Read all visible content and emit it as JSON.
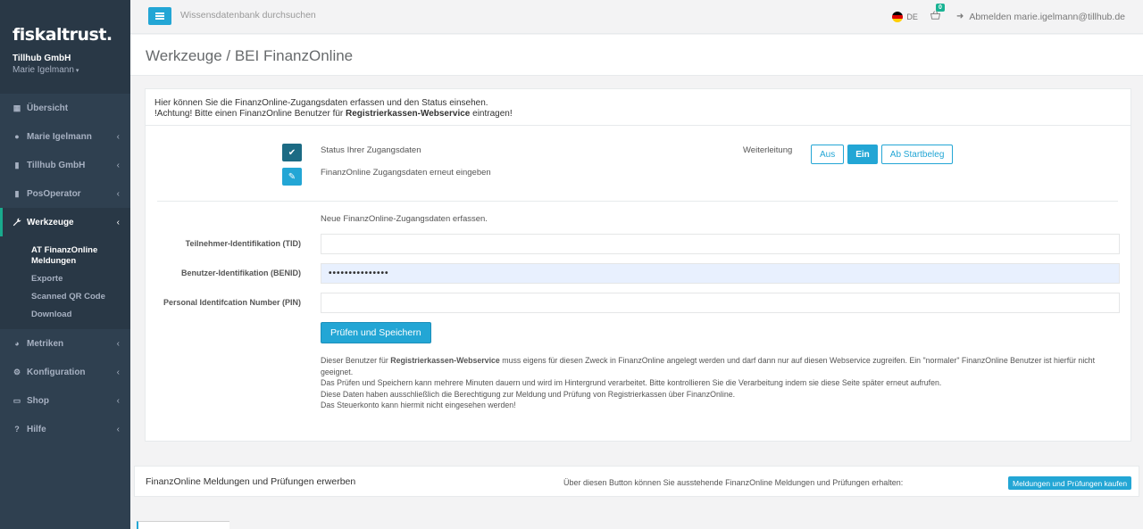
{
  "brand": {
    "logo": "fiskaltrust.",
    "company": "Tillhub GmbH",
    "user": "Marie Igelmann",
    "user_caret": "▾"
  },
  "sidebar": {
    "items": [
      {
        "label": "Übersicht",
        "icon": "th-large-icon",
        "glyph": "▦",
        "chevron": ""
      },
      {
        "label": "Marie Igelmann",
        "icon": "user-icon",
        "glyph": "●",
        "chevron": "‹"
      },
      {
        "label": "Tillhub GmbH",
        "icon": "building-icon",
        "glyph": "▮",
        "chevron": "‹"
      },
      {
        "label": "PosOperator",
        "icon": "building-icon",
        "glyph": "▮",
        "chevron": "‹"
      },
      {
        "label": "Werkzeuge",
        "icon": "wrench-icon",
        "glyph": "🔧",
        "chevron": "‹"
      },
      {
        "label": "Metriken",
        "icon": "pie-chart-icon",
        "glyph": "◕",
        "chevron": "‹"
      },
      {
        "label": "Konfiguration",
        "icon": "cogs-icon",
        "glyph": "⚙",
        "chevron": "‹"
      },
      {
        "label": "Shop",
        "icon": "cart-icon",
        "glyph": "▭",
        "chevron": "‹"
      },
      {
        "label": "Hilfe",
        "icon": "question-icon",
        "glyph": "?",
        "chevron": "‹"
      }
    ],
    "submenu": [
      {
        "label": "AT FinanzOnline Meldungen"
      },
      {
        "label": "Exporte"
      },
      {
        "label": "Scanned QR Code"
      },
      {
        "label": "Download"
      }
    ]
  },
  "topbar": {
    "search_placeholder": "Wissensdatenbank durchsuchen",
    "lang": "DE",
    "cart_count": "0",
    "logout_label": "Abmelden marie.igelmann@tillhub.de"
  },
  "page": {
    "title": "Werkzeuge / BEI FinanzOnline"
  },
  "intro": {
    "line1": "Hier können Sie die FinanzOnline-Zugangsdaten erfassen und den Status einsehen.",
    "line2_pre": "!Achtung! Bitte einen FinanzOnline Benutzer für ",
    "line2_bold": "Registrierkassen-Webservice",
    "line2_post": " eintragen!"
  },
  "status": {
    "status_label": "Status Ihrer Zugangsdaten",
    "reenter_label": "FinanzOnline Zugangsdaten erneut eingeben",
    "forward_label": "Weiterleitung",
    "buttons": {
      "off": "Aus",
      "on": "Ein",
      "from_start": "Ab Startbeleg"
    }
  },
  "form": {
    "intro": "Neue FinanzOnline-Zugangsdaten erfassen.",
    "tid_label": "Teilnehmer-Identifikation (TID)",
    "tid_value": "",
    "benid_label": "Benutzer-Identifikation (BENID)",
    "benid_value": "•••••••••••••••",
    "pin_label": "Personal Identifcation Number (PIN)",
    "pin_value": "",
    "save_label": "Prüfen und Speichern"
  },
  "notes": {
    "p1_pre": "Dieser Benutzer für ",
    "p1_bold": "Registrierkassen-Webservice",
    "p1_post": " muss eigens für diesen Zweck in FinanzOnline angelegt werden und darf dann nur auf diesen Webservice zugreifen. Ein \"normaler\" FinanzOnline Benutzer ist hierfür nicht geeignet.",
    "p2": "Das Prüfen und Speichern kann mehrere Minuten dauern und wird im Hintergrund verarbeitet. Bitte kontrollieren Sie die Verarbeitung indem sie diese Seite später erneut aufrufen.",
    "p3": "Diese Daten haben ausschließlich die Berechtigung zur Meldung und Prüfung von Registrierkassen über FinanzOnline.",
    "p4": "Das Steuerkonto kann hiermit nicht eingesehen werden!"
  },
  "purchase": {
    "title": "FinanzOnline Meldungen und Prüfungen erwerben",
    "note": "Über diesen Button können Sie ausstehende FinanzOnline Meldungen und Prüfungen erhalten:",
    "button": "Meldungen und Prüfungen kaufen"
  },
  "colors": {
    "sidebar": "#2f4050",
    "accent": "#23a6d5",
    "active_border": "#19aa8d",
    "status_dark": "#1c6b84"
  }
}
